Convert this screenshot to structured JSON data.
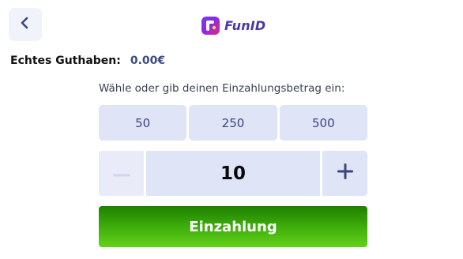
{
  "header": {
    "back_icon": "chevron-left-icon",
    "logo_icon": "funid-logo-icon",
    "logo_text": "FunID"
  },
  "balance": {
    "label": "Echtes Guthaben:",
    "value": "0.00€"
  },
  "deposit": {
    "prompt": "Wähle oder gib deinen Einzahlungsbetrag ein:",
    "presets": [
      "50",
      "250",
      "500"
    ],
    "amount": "10",
    "minus_icon": "minus-icon",
    "plus_icon": "plus-icon",
    "button_label": "Einzahlung"
  },
  "colors": {
    "accent_dark": "#3b4680",
    "tile_bg": "#dfe4f6",
    "button_green_top": "#1f7f00",
    "button_green_bottom": "#63d21a"
  }
}
